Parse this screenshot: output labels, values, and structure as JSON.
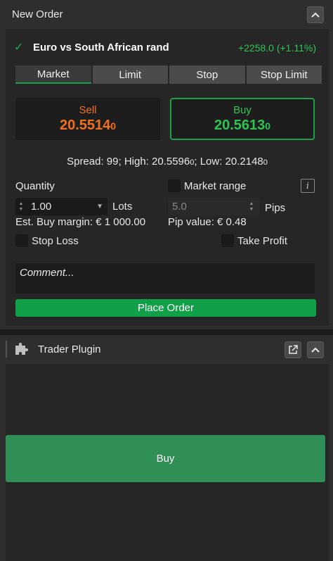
{
  "new_order": {
    "title": "New Order",
    "symbol": "Euro vs South African rand",
    "change": "+2258.0 (+1.11%)",
    "tabs": [
      "Market",
      "Limit",
      "Stop",
      "Stop Limit"
    ],
    "active_tab": "Market",
    "sell": {
      "label": "Sell",
      "price_main": "20.5514",
      "price_pip": "0"
    },
    "buy": {
      "label": "Buy",
      "price_main": "20.5613",
      "price_pip": "0"
    },
    "spread": {
      "prefix": "Spread: 99; High: 20.5596",
      "high_pip": "0",
      "mid": "; Low: 20.2148",
      "low_pip": "0"
    },
    "quantity_label": "Quantity",
    "quantity_value": "1.00",
    "quantity_unit": "Lots",
    "market_range_label": "Market range",
    "info_icon": "i",
    "market_range_value": "5.0",
    "market_range_unit": "Pips",
    "est_margin": "Est. Buy margin: € 1 000.00",
    "pip_value": "Pip value: € 0.48",
    "stop_loss_label": "Stop Loss",
    "take_profit_label": "Take Profit",
    "comment_placeholder": "Comment...",
    "place_order_label": "Place Order",
    "colors": {
      "sell": "#f26f21",
      "buy": "#2ec454",
      "accent": "#11a047"
    }
  },
  "trader_plugin": {
    "title": "Trader Plugin",
    "buy_label": "Buy",
    "icons": [
      "puzzle-icon",
      "external-link-icon",
      "chevron-up-icon"
    ]
  }
}
